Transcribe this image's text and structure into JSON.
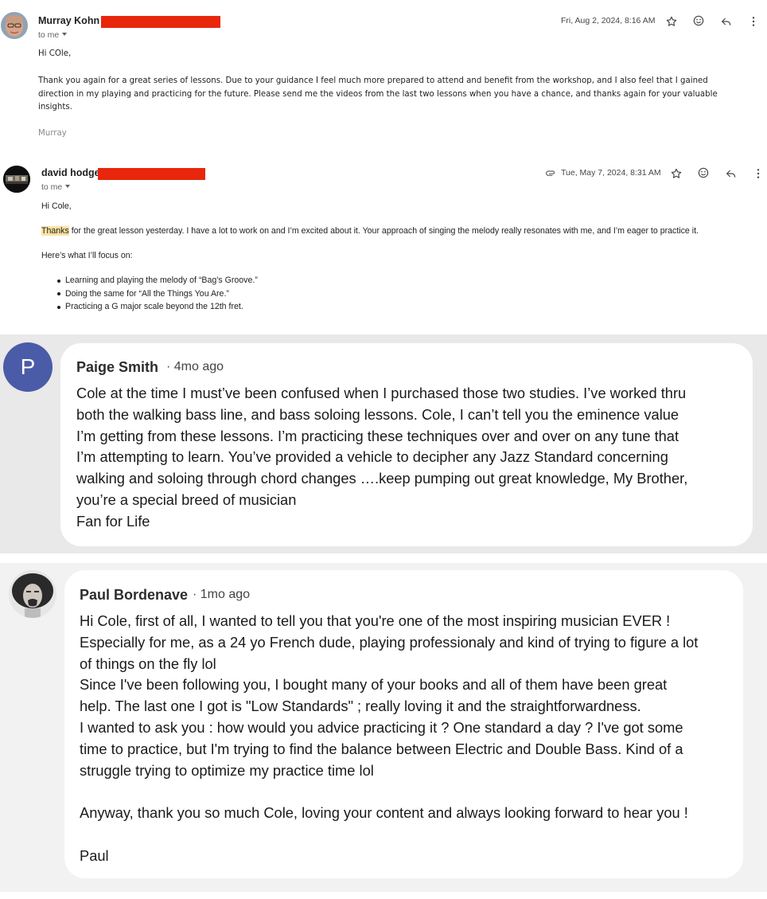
{
  "email1": {
    "sender": "Murray Kohn",
    "to": "to me",
    "date": "Fri, Aug 2, 2024, 8:16 AM",
    "greeting": "Hi COle,",
    "body_lines": [
      "Thank you again for a great series of lessons. Due to your guidance I feel much more prepared to attend and benefit from the workshop, and I also feel that I gained",
      "direction in my playing and practicing for the future.  Please send me the videos from the last two lessons when you have a chance, and thanks again for your valuable",
      "insights."
    ],
    "signature": "Murray",
    "icons": [
      "star-icon",
      "emoji-icon",
      "reply-icon",
      "more-vert-icon"
    ]
  },
  "email2": {
    "sender": "david hodge",
    "to": "to me",
    "date": "Tue, May 7, 2024, 8:31 AM",
    "greeting": "Hi Cole,",
    "highlight": "Thanks",
    "line1_rest": " for the great lesson yesterday. I have a lot to work on and I’m excited about it. Your approach of singing the melody really resonates with me, and I’m eager to practice it.",
    "focus_intro": "Here’s what I’ll focus on:",
    "focus_items": [
      "Learning and playing the melody of “Bag’s Groove.”",
      "Doing the same for “All the Things You Are.”",
      "Practicing a G major scale beyond the 12th fret."
    ],
    "icons": [
      "attachment-icon",
      "star-icon",
      "emoji-icon",
      "reply-icon",
      "more-vert-icon"
    ]
  },
  "comment1": {
    "initial": "P",
    "avatar_color": "#4a5ba8",
    "author": "Paige Smith",
    "time": "· 4mo ago",
    "lines": [
      "Cole at the time I must’ve been confused when I purchased those two studies. I’ve worked thru",
      "both the walking bass line, and bass soloing lessons. Cole, I can’t tell you the eminence value",
      "I’m getting from these lessons. I’m practicing these techniques over and over on any tune that",
      "I’m attempting to learn. You’ve provided a vehicle to decipher any Jazz Standard concerning",
      "walking and soloing through chord changes ….keep pumping out great knowledge, My Brother,",
      "you’re a special breed of musician",
      "Fan for Life"
    ]
  },
  "comment2": {
    "author": "Paul Bordenave",
    "time": "· 1mo ago",
    "lines": [
      "Hi Cole, first of all, I wanted to tell you that you're one of the most inspiring musician EVER !",
      "Especially for me, as a 24 yo French dude, playing professionaly and kind of trying to figure a lot",
      "of things on the fly lol",
      "Since I've been following you, I bought many of your books and all of them have been great",
      "help. The last one I got is \"Low Standards\" ; really loving it and the straightforwardness.",
      "I wanted to ask you : how would you advice practicing it ? One standard a day ? I've got some",
      "time to practice, but I'm trying to find the balance between Electric and Double Bass. Kind of a",
      "struggle trying to optimize my practice time lol",
      "",
      "Anyway, thank you so much Cole, loving your content and always looking forward to hear you !",
      "",
      "Paul"
    ]
  },
  "colors": {
    "redaction": "#e8260c",
    "highlight": "#fbe3a3",
    "comment1_bg": "#e9e9e9",
    "comment2_bg": "#f2f2f2"
  }
}
